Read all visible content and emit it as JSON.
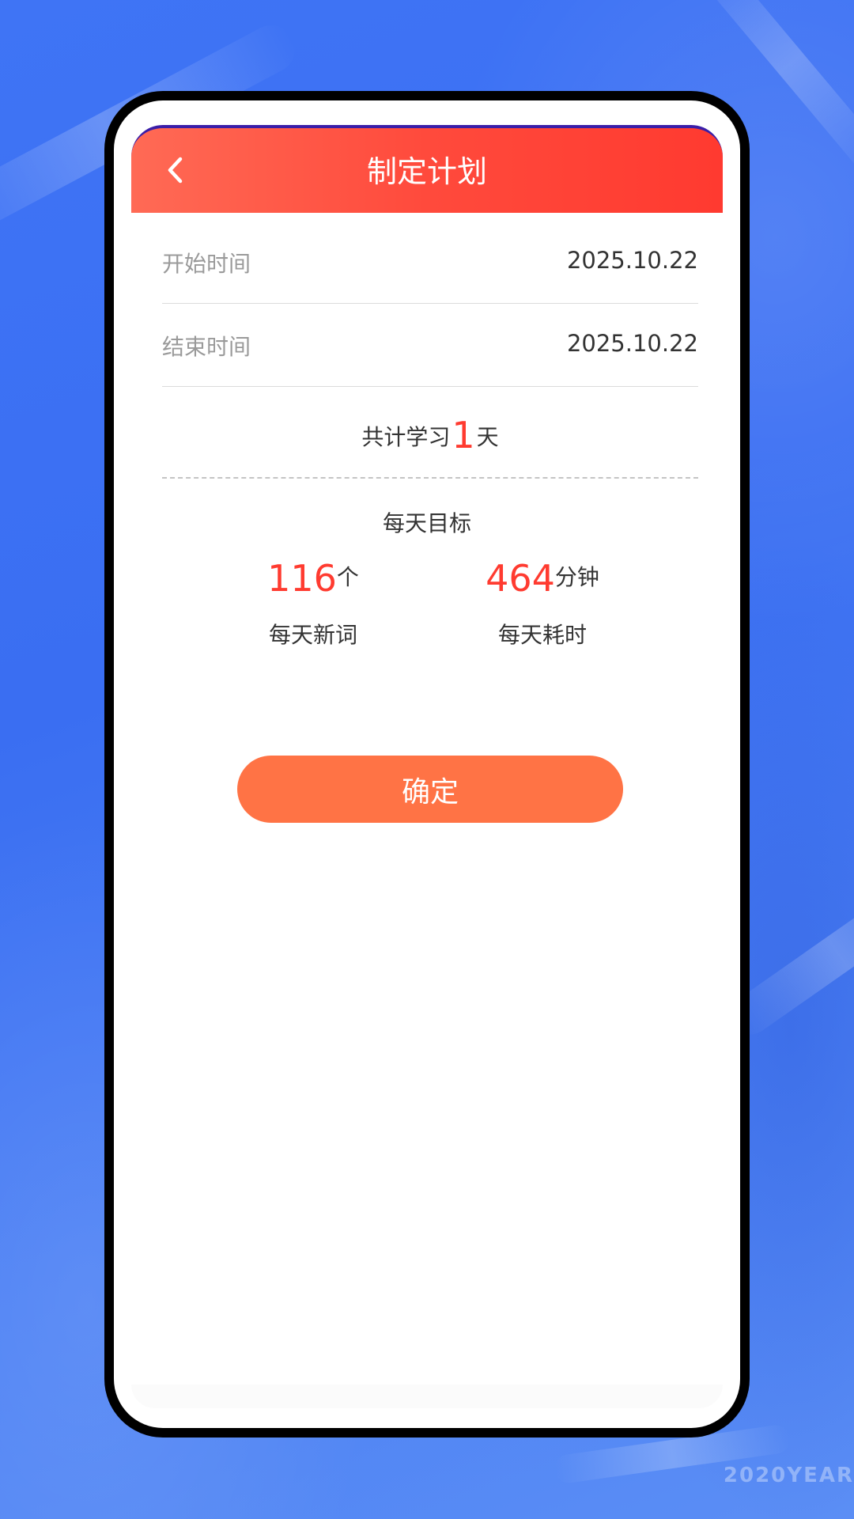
{
  "header": {
    "title": "制定计划",
    "back_icon": "chevron-left-icon"
  },
  "plan": {
    "start_label": "开始时间",
    "start_value": "2025.10.22",
    "end_label": "结束时间",
    "end_value": "2025.10.22",
    "total_prefix": "共计学习",
    "total_days": "1",
    "total_suffix": "天"
  },
  "goal": {
    "title": "每天目标",
    "words_value": "116",
    "words_unit": "个",
    "words_label": "每天新词",
    "time_value": "464",
    "time_unit": "分钟",
    "time_label": "每天耗时"
  },
  "actions": {
    "confirm_label": "确定"
  },
  "watermark": "2020YEAR",
  "colors": {
    "header_start": "#ff6a55",
    "header_end": "#ff3a30",
    "accent_red": "#ff3b30",
    "button": "#ff7345",
    "background": "#3f74f5"
  }
}
